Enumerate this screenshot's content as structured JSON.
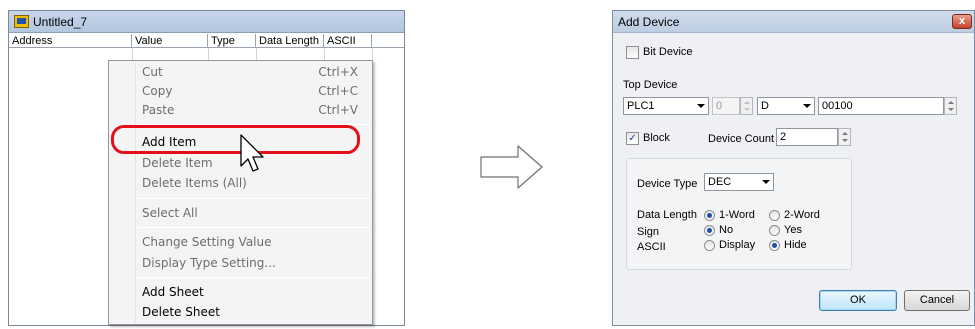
{
  "left_window": {
    "title": "Untitled_7",
    "columns": [
      "Address",
      "Value",
      "Type",
      "Data Length",
      "ASCII"
    ]
  },
  "context_menu": {
    "groups": [
      [
        {
          "label": "Cut",
          "shortcut": "Ctrl+X",
          "enabled": false
        },
        {
          "label": "Copy",
          "shortcut": "Ctrl+C",
          "enabled": false
        },
        {
          "label": "Paste",
          "shortcut": "Ctrl+V",
          "enabled": false
        }
      ],
      [
        {
          "label": "Add Item",
          "shortcut": "",
          "enabled": true
        },
        {
          "label": "Delete Item",
          "shortcut": "",
          "enabled": false
        },
        {
          "label": "Delete Items (All)",
          "shortcut": "",
          "enabled": false
        }
      ],
      [
        {
          "label": "Select All",
          "shortcut": "",
          "enabled": false
        }
      ],
      [
        {
          "label": "Change Setting Value",
          "shortcut": "",
          "enabled": false
        },
        {
          "label": "Display Type Setting...",
          "shortcut": "",
          "enabled": false
        }
      ],
      [
        {
          "label": "Add Sheet",
          "shortcut": "",
          "enabled": true
        },
        {
          "label": "Delete Sheet",
          "shortcut": "",
          "enabled": true
        }
      ]
    ],
    "highlighted_item": "Add Item"
  },
  "dialog": {
    "title": "Add Device",
    "close_glyph": "x",
    "bit_device_label": "Bit Device",
    "bit_device_checked": false,
    "top_device_label": "Top Device",
    "plc_value": "PLC1",
    "station_value": "0",
    "device_value": "D",
    "address_value": "00100",
    "block_label": "Block",
    "block_checked": true,
    "block_check_glyph": "✓",
    "device_count_label": "Device Count",
    "device_count_value": "2",
    "device_type_label": "Device Type",
    "device_type_value": "DEC",
    "data_length_label": "Data Length",
    "data_length_options": [
      "1-Word",
      "2-Word"
    ],
    "data_length_selected": "1-Word",
    "sign_label": "Sign",
    "sign_options": [
      "No",
      "Yes"
    ],
    "sign_selected": "No",
    "ascii_label": "ASCII",
    "ascii_options": [
      "Display",
      "Hide"
    ],
    "ascii_selected": "Hide",
    "ok_label": "OK",
    "cancel_label": "Cancel"
  },
  "colors": {
    "highlight_ring": "#e3101a",
    "title_bar": "#c6d6ea",
    "dialog_bg": "#eef0f4"
  }
}
